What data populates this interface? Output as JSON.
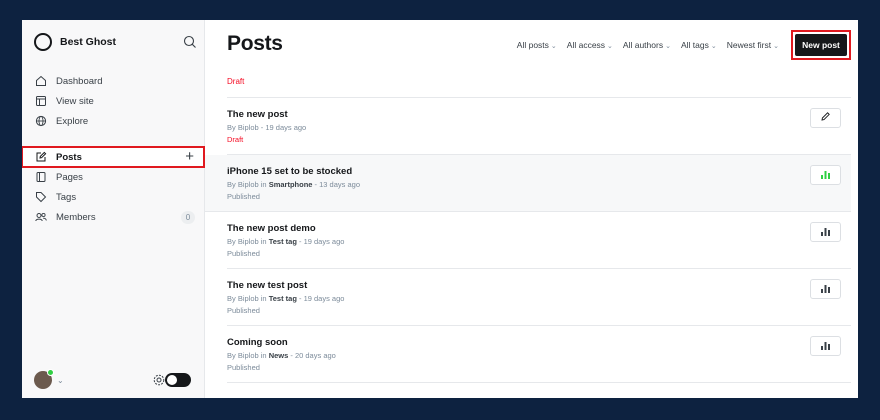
{
  "sidebar": {
    "brand": "Best Ghost",
    "nav_top": [
      {
        "label": "Dashboard",
        "icon": "home-icon"
      },
      {
        "label": "View site",
        "icon": "window-icon"
      },
      {
        "label": "Explore",
        "icon": "globe-icon"
      }
    ],
    "nav_main": [
      {
        "label": "Posts",
        "icon": "pencil-square-icon",
        "active": true
      },
      {
        "label": "Pages",
        "icon": "pages-icon"
      },
      {
        "label": "Tags",
        "icon": "tag-icon"
      },
      {
        "label": "Members",
        "icon": "members-icon",
        "count": "0"
      }
    ]
  },
  "header": {
    "title": "Posts",
    "filters": [
      "All posts",
      "All access",
      "All authors",
      "All tags",
      "Newest first"
    ],
    "new_post": "New post"
  },
  "draft_label": "Draft",
  "posts": [
    {
      "title": "The new post",
      "meta_prefix": "By Biplob",
      "meta_tag": "",
      "meta_suffix": " - 19 days ago",
      "status": "Draft",
      "action": "edit"
    },
    {
      "title": "iPhone 15 set to be stocked",
      "meta_prefix": "By Biplob in ",
      "meta_tag": "Smartphone",
      "meta_suffix": " - 13 days ago",
      "status": "Published",
      "action": "stats-green"
    },
    {
      "title": "The new post demo",
      "meta_prefix": "By Biplob in ",
      "meta_tag": "Test tag",
      "meta_suffix": " - 19 days ago",
      "status": "Published",
      "action": "stats"
    },
    {
      "title": "The new test post",
      "meta_prefix": "By Biplob in ",
      "meta_tag": "Test tag",
      "meta_suffix": " - 19 days ago",
      "status": "Published",
      "action": "stats"
    },
    {
      "title": "Coming soon",
      "meta_prefix": "By Biplob in ",
      "meta_tag": "News",
      "meta_suffix": " - 20 days ago",
      "status": "Published",
      "action": "stats"
    }
  ],
  "colors": {
    "accent_red": "#e0191f",
    "draft": "#f50b23",
    "stats_green": "#30cf43",
    "dark": "#15171a"
  }
}
